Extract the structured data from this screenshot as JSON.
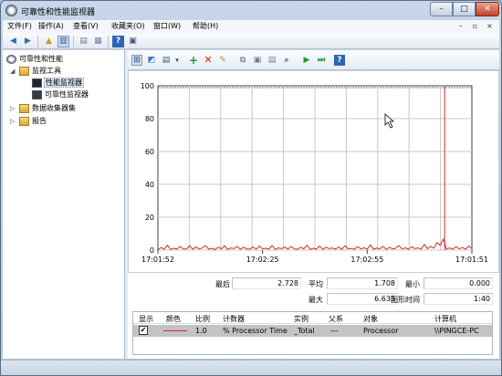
{
  "window": {
    "title": "可靠性和性能监视器"
  },
  "caption": {
    "minimize": "–",
    "maximize": "□",
    "close": "✕"
  },
  "menu": {
    "items": [
      "文件(F)",
      "操作(A)",
      "查看(V)",
      "收藏夹(O)",
      "窗口(W)",
      "帮助(H)"
    ],
    "right": {
      "minimize": "–",
      "restore": "▫",
      "close": "×"
    }
  },
  "toolbar": {
    "icons": [
      "back-arrow-icon",
      "forward-arrow-icon",
      "up-folder-icon",
      "console-tree-icon",
      "properties-icon",
      "export-icon",
      "help-icon"
    ]
  },
  "tree": {
    "root": "可靠性和性能",
    "monitor_tools": "监视工具",
    "perf_monitor": "性能监视器",
    "reliability_monitor": "可靠性监视器",
    "data_collector_sets": "数据收集器集",
    "reports": "报告"
  },
  "graph": {
    "y_ticks": [
      "100",
      "80",
      "60",
      "40",
      "20",
      "0"
    ],
    "x_ticks": [
      "17:01:52",
      "17:02:25",
      "17:02:55",
      "17:01:51"
    ],
    "line_color": "#e0232a"
  },
  "chart_data": {
    "type": "line",
    "ylim": [
      0,
      100
    ],
    "grid": true,
    "x_tick_labels": [
      "17:01:52",
      "17:02:25",
      "17:02:55",
      "17:01:51"
    ],
    "series": [
      {
        "name": "% Processor Time",
        "values": [
          0,
          1.6,
          0.5,
          2.9,
          0.4,
          1.1,
          0.6,
          2.1,
          0.8,
          0.6,
          2.6,
          0.5,
          1.9,
          0.7,
          1.2,
          2.8,
          0.6,
          1.1,
          0.3,
          1.7,
          0.8,
          2.5,
          0.4,
          1.3,
          0.9,
          2.2,
          0.5,
          1.6,
          0.7,
          0.6,
          1.9,
          0.5,
          2.4,
          0.8,
          1.1,
          0.6,
          2.7,
          0.4,
          1.3,
          0.9,
          1.8,
          0.6,
          2.2,
          0.7,
          0.5,
          1.6,
          0.8,
          2.9,
          0.4,
          1.1,
          0.6,
          2.4,
          0.5,
          1.7,
          0.9,
          1.2,
          0.6,
          1.9,
          0.4,
          2.6,
          0.8,
          1.0,
          0.5,
          2.1,
          0.7,
          1.4,
          0.6,
          3.1,
          0.5,
          1.2,
          0.8,
          2.3,
          0.4,
          1.6,
          0.7,
          1.1,
          2.8,
          0.6,
          1.4,
          0.5,
          2.0,
          0.9,
          1.3,
          0.6,
          3.4,
          0.8,
          2.2,
          1.1,
          4.5,
          2.9,
          6.6,
          0.6,
          1.3,
          0.5,
          2.1,
          0.8,
          1.5,
          0.6,
          2.4,
          0.9
        ]
      }
    ]
  },
  "cursor_marker_index": 91,
  "stats": {
    "last_label": "最后",
    "last_value": "2.728",
    "avg_label": "平均",
    "avg_value": "1.708",
    "min_label": "最小",
    "min_value": "0.000",
    "max_label": "最大",
    "max_value": "6.635",
    "duration_label": "图形时间",
    "duration_value": "1:40"
  },
  "legend": {
    "headers": {
      "show": "显示",
      "color": "颜色",
      "scale": "比例",
      "counter": "计数器",
      "instance": "实例",
      "parent": "父系",
      "object": "对象",
      "computer": "计算机"
    },
    "row": {
      "checked": "✔",
      "scale": "1.0",
      "counter": "% Processor Time",
      "instance": "_Total",
      "parent": "---",
      "object": "Processor",
      "computer": "\\\\PINGCE-PC"
    }
  }
}
